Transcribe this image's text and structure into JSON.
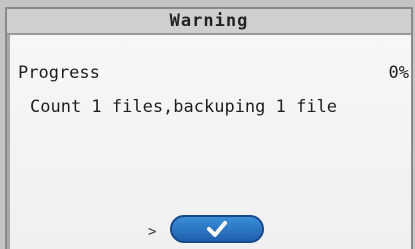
{
  "dialog": {
    "title": "Warning",
    "progress_label": "Progress",
    "progress_value": "0%",
    "message": "Count 1 files,backuping 1 file"
  },
  "buttons": {
    "ok_icon": "checkmark-icon"
  },
  "colors": {
    "button_blue": "#1f5fae",
    "dialog_background": "#f2f2f2",
    "titlebar_background": "#cfcfcf"
  }
}
